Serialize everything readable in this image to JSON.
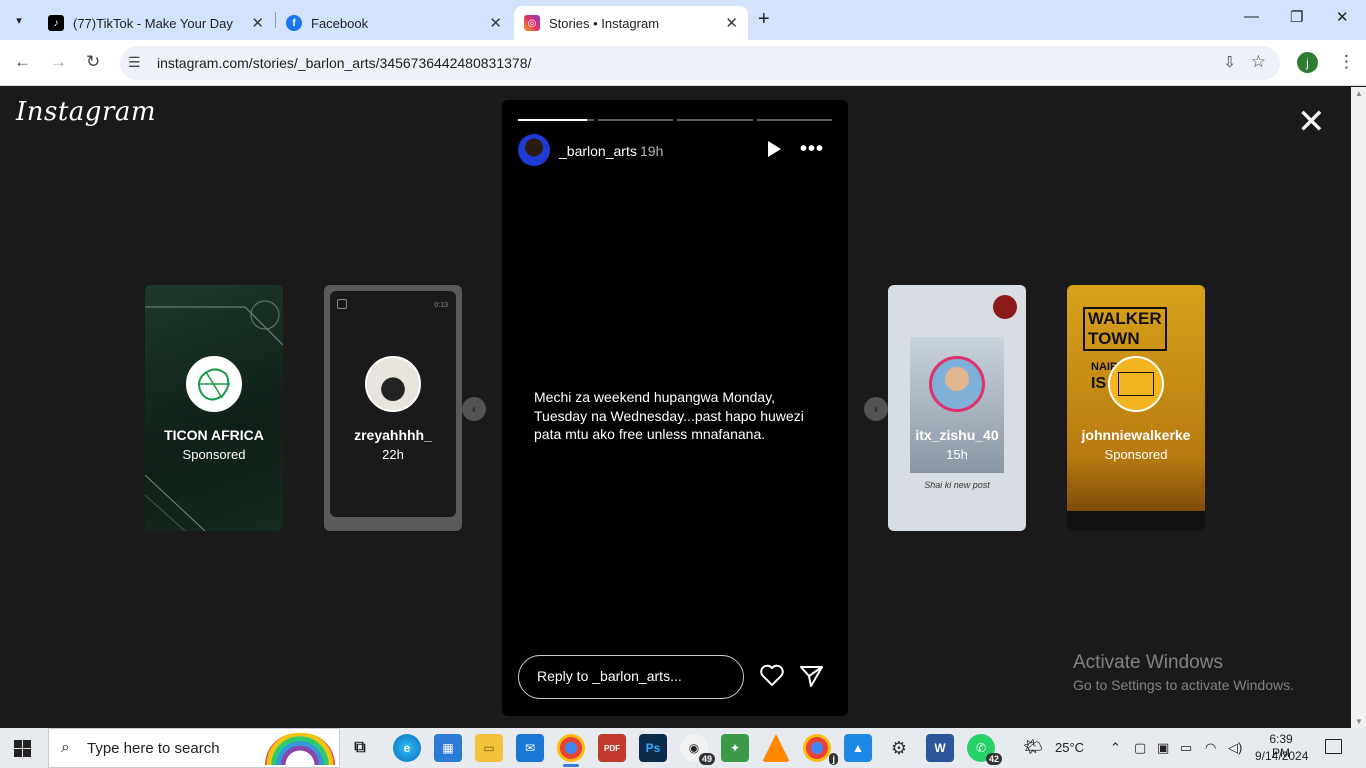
{
  "browser": {
    "tabs": [
      {
        "title": "(77)TikTok - Make Your Day",
        "favicon": "tiktok-icon"
      },
      {
        "title": "Facebook",
        "favicon": "facebook-icon"
      },
      {
        "title": "Stories • Instagram",
        "favicon": "instagram-icon",
        "active": true
      }
    ],
    "url": "instagram.com/stories/_barlon_arts/3456736442480831378/",
    "profile_initial": "j"
  },
  "page": {
    "logo": "Instagram",
    "story": {
      "username": "_barlon_arts",
      "time": "19h",
      "segments": 4,
      "emoji": "😂😂",
      "text": "Mechi za weekend hupangwa Monday, Tuesday na Wednesday...past hapo huwezi pata mtu ako free unless mnafanana.",
      "reply_placeholder": "Reply to _barlon_arts..."
    },
    "side_stories": [
      {
        "name": "TICON AFRICA",
        "sub": "Sponsored"
      },
      {
        "name": "zreyahhhh_",
        "sub": "22h",
        "duration": "0:13"
      },
      {
        "name": "itx_zishu_40",
        "sub": "15h",
        "caption": "Shai ki new post"
      },
      {
        "name": "johnniewalkerke",
        "sub": "Sponsored",
        "brand_lines": [
          "WALKER",
          "TOWN",
          "NAIRO",
          "IS"
        ]
      }
    ],
    "watermark": {
      "title": "Activate Windows",
      "subtitle": "Go to Settings to activate Windows."
    }
  },
  "taskbar": {
    "search_placeholder": "Type here to search",
    "chrome_badge": "j",
    "whatsapp_badge": "42",
    "app_badge": "49",
    "weather": "25°C",
    "time": "6:39 PM",
    "date": "9/14/2024"
  },
  "colors": {
    "tabbar": "#d3e3fd",
    "page_bg": "#1a1a1a",
    "story_bg": "#000000",
    "taskbar": "#e7ebf0"
  }
}
